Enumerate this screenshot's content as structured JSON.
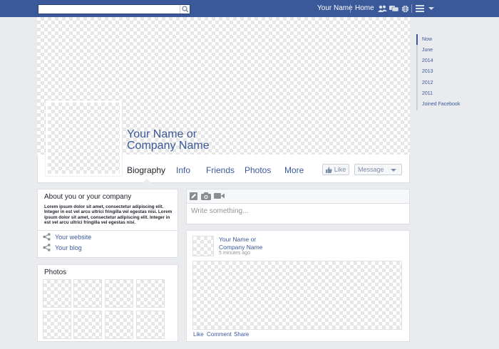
{
  "topbar": {
    "search": {
      "value": "",
      "placeholder": ""
    },
    "user_link": "Your Name",
    "home_link": "Home",
    "icons": [
      "friend-requests-icon",
      "messages-icon",
      "notifications-globe-icon",
      "settings-menu-icon",
      "dropdown-caret-icon"
    ],
    "bar_color": "#3b5998"
  },
  "profile": {
    "name_line1": "Your Name or",
    "name_line2": "Company Name"
  },
  "tabs": [
    {
      "label": "Biography",
      "active": true
    },
    {
      "label": "Info",
      "active": false
    },
    {
      "label": "Friends",
      "active": false
    },
    {
      "label": "Photos",
      "active": false
    },
    {
      "label": "More",
      "active": false
    }
  ],
  "actions": {
    "like_label": "Like",
    "message_label": "Message"
  },
  "timeline": {
    "items": [
      "Now",
      "June",
      "2014",
      "2013",
      "2012",
      "2011",
      "Joined Facebook"
    ],
    "active_index": 0
  },
  "about": {
    "title": "About you or your company",
    "body": "Lorem ipsum dolor sit amet, consectetur adipiscing elit. Integer in est vel arcu ultrici fringilla vel egestas nisi. Lorem ipsum dolor sit amet, consectetur adipiscing elit. Integer in est vel arcu ultrici fringilla vel egestas nisi.",
    "links": [
      {
        "label": "Your website",
        "icon": "share-icon"
      },
      {
        "label": "Your blog",
        "icon": "share-icon"
      }
    ]
  },
  "photos": {
    "title": "Photos"
  },
  "composer": {
    "placeholder": "Write something...",
    "icons": [
      "status-pencil-icon",
      "photo-camera-icon",
      "video-camera-icon"
    ]
  },
  "post": {
    "author_line1": "Your Name or",
    "author_line2": "Company Name",
    "time": "5 minutes ago",
    "actions": [
      "Like",
      "Comment",
      "Share"
    ]
  },
  "colors": {
    "brand": "#3b5998",
    "page_bg": "#e9ebee"
  }
}
